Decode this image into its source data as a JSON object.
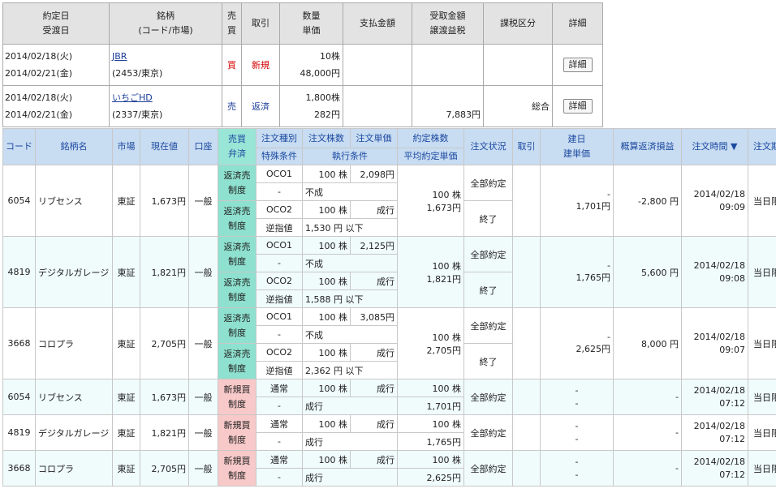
{
  "top": {
    "headers": {
      "date1": "約定日",
      "date2": "受渡日",
      "name1": "銘柄",
      "name2": "(コード/市場)",
      "side1": "売",
      "side2": "買",
      "trade": "取引",
      "qty1": "数量",
      "qty2": "単価",
      "pay": "支払金額",
      "recv1": "受取金額",
      "recv2": "譲渡益税",
      "tax": "課税区分",
      "detail": "詳細"
    },
    "rows": [
      {
        "date": "2014/02/18(火)",
        "settle": "2014/02/21(金)",
        "name": "JBR",
        "code": "(2453/東京)",
        "side": "買",
        "trade": "新規",
        "qty": "10株",
        "price": "48,000円",
        "pay": "",
        "recv": "",
        "recv2": "",
        "tax": "",
        "detail": "詳細"
      },
      {
        "date": "2014/02/18(火)",
        "settle": "2014/02/21(金)",
        "name": "いちごHD",
        "code": "(2337/東京)",
        "side": "売",
        "trade": "返済",
        "qty": "1,800株",
        "price": "282円",
        "pay": "",
        "recv": "",
        "recv2": "7,883円",
        "tax": "総合",
        "detail": "詳細"
      }
    ]
  },
  "orders": {
    "headers": {
      "code": "コード",
      "name": "銘柄名",
      "market": "市場",
      "price": "現在値",
      "account": "口座",
      "bs1": "売買",
      "bs2": "弁済",
      "type": "注文種別",
      "special": "特殊条件",
      "qty": "注文株数",
      "unit": "注文単価",
      "exec": "執行条件",
      "done": "約定株数",
      "avg": "平均約定単価",
      "status": "注文状況",
      "cancel": "取引",
      "build1": "建日",
      "build2": "建単価",
      "pl": "概算返済損益",
      "time": "注文時間 ▼",
      "expiry": "注文期限"
    },
    "oco_rows": [
      {
        "code": "6054",
        "name": "リブセンス",
        "market": "東証",
        "price": "1,673円",
        "account": "一般",
        "bs": "返済売\n制度",
        "type1": "OCO1",
        "qty1": "100 株",
        "unit1": "2,098円",
        "spec1": "-",
        "exec1": "不成",
        "type2": "OCO2",
        "qty2": "100 株",
        "unit2": "成行",
        "spec2": "逆指値",
        "exec2": "1,530 円 以下",
        "done": "100 株",
        "avg": "1,673円",
        "status1": "全部約定",
        "status2": "終了",
        "build1": "-",
        "build2": "1,701円",
        "pl": "-2,800 円",
        "date": "2014/02/18",
        "time": "09:09",
        "expiry": "当日限り"
      },
      {
        "code": "4819",
        "name": "デジタルガレージ",
        "market": "東証",
        "price": "1,821円",
        "account": "一般",
        "bs": "返済売\n制度",
        "type1": "OCO1",
        "qty1": "100 株",
        "unit1": "2,125円",
        "spec1": "-",
        "exec1": "不成",
        "type2": "OCO2",
        "qty2": "100 株",
        "unit2": "成行",
        "spec2": "逆指値",
        "exec2": "1,588 円 以下",
        "done": "100 株",
        "avg": "1,821円",
        "status1": "全部約定",
        "status2": "終了",
        "build1": "-",
        "build2": "1,765円",
        "pl": "5,600 円",
        "date": "2014/02/18",
        "time": "09:08",
        "expiry": "当日限り"
      },
      {
        "code": "3668",
        "name": "コロプラ",
        "market": "東証",
        "price": "2,705円",
        "account": "一般",
        "bs": "返済売\n制度",
        "type1": "OCO1",
        "qty1": "100 株",
        "unit1": "3,085円",
        "spec1": "-",
        "exec1": "不成",
        "type2": "OCO2",
        "qty2": "100 株",
        "unit2": "成行",
        "spec2": "逆指値",
        "exec2": "2,362 円 以下",
        "done": "100 株",
        "avg": "2,705円",
        "status1": "全部約定",
        "status2": "終了",
        "build1": "-",
        "build2": "2,625円",
        "pl": "8,000 円",
        "date": "2014/02/18",
        "time": "09:07",
        "expiry": "当日限り"
      }
    ],
    "new_rows": [
      {
        "code": "6054",
        "name": "リブセンス",
        "market": "東証",
        "price": "1,673円",
        "account": "一般",
        "bs": "新規買\n制度",
        "type": "通常",
        "qty": "100 株",
        "unit": "成行",
        "spec": "-",
        "exec": "成行",
        "done": "100 株",
        "avg": "1,701円",
        "status": "全部約定",
        "build1": "-",
        "build2": "-",
        "pl": "-",
        "date": "2014/02/18",
        "time": "07:12",
        "expiry": "当日限り"
      },
      {
        "code": "4819",
        "name": "デジタルガレージ",
        "market": "東証",
        "price": "1,821円",
        "account": "一般",
        "bs": "新規買\n制度",
        "type": "通常",
        "qty": "100 株",
        "unit": "成行",
        "spec": "-",
        "exec": "成行",
        "done": "100 株",
        "avg": "1,765円",
        "status": "全部約定",
        "build1": "-",
        "build2": "-",
        "pl": "-",
        "date": "2014/02/18",
        "time": "07:12",
        "expiry": "当日限り"
      },
      {
        "code": "3668",
        "name": "コロプラ",
        "market": "東証",
        "price": "2,705円",
        "account": "一般",
        "bs": "新規買\n制度",
        "type": "通常",
        "qty": "100 株",
        "unit": "成行",
        "spec": "-",
        "exec": "成行",
        "done": "100 株",
        "avg": "2,625円",
        "status": "全部約定",
        "build1": "-",
        "build2": "-",
        "pl": "-",
        "date": "2014/02/18",
        "time": "07:12",
        "expiry": "当日限り"
      }
    ]
  }
}
